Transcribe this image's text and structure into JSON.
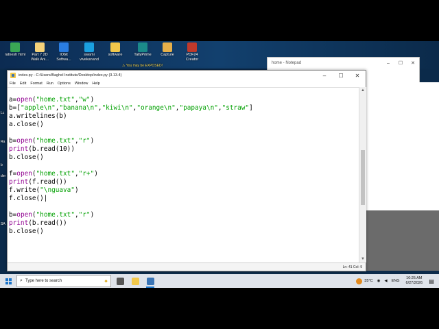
{
  "desktop": {
    "icons": [
      {
        "label": "ratnesh html",
        "color": "#3aa655"
      },
      {
        "label": "Part 7 2D\nWalk Ani...",
        "color": "#f4d27a"
      },
      {
        "label": "IObit\nSoftwa...",
        "color": "#2a7de1"
      },
      {
        "label": "swami\nvivekanand",
        "color": "#1aa0e0"
      },
      {
        "label": "software",
        "color": "#f2c84b"
      },
      {
        "label": "TallyPrime",
        "color": "#1b8a8a"
      },
      {
        "label": "Capture",
        "color": "#e6b04a"
      },
      {
        "label": "PDF24\nCreator",
        "color": "#c0392b"
      }
    ],
    "edge_labels": [
      "Lc",
      "Ra",
      "b",
      "der",
      "SA"
    ],
    "warning": "You may be EXPOSED!"
  },
  "notepad": {
    "title": "home - Notepad",
    "buttons": [
      "–",
      "☐",
      "✕"
    ]
  },
  "idle": {
    "title": "index.py - C:/Users/Baghel Institute/Desktop/index.py (3.13.4)",
    "window_buttons": [
      "–",
      "☐",
      "✕"
    ],
    "menu": [
      "File",
      "Edit",
      "Format",
      "Run",
      "Options",
      "Window",
      "Help"
    ],
    "status": "Ln: 41   Col: 9",
    "code": [
      "",
      [
        {
          "t": "a="
        },
        {
          "t": "open",
          "c": "kw"
        },
        {
          "t": "("
        },
        {
          "t": "\"home.txt\"",
          "c": "st"
        },
        {
          "t": ","
        },
        {
          "t": "\"w\"",
          "c": "st"
        },
        {
          "t": ")"
        }
      ],
      [
        {
          "t": "b=["
        },
        {
          "t": "\"apple\\n\"",
          "c": "st"
        },
        {
          "t": ","
        },
        {
          "t": "\"banana\\n\"",
          "c": "st"
        },
        {
          "t": ","
        },
        {
          "t": "\"kiwi\\n\"",
          "c": "st"
        },
        {
          "t": ","
        },
        {
          "t": "\"orange\\n\"",
          "c": "st"
        },
        {
          "t": ","
        },
        {
          "t": "\"papaya\\n\"",
          "c": "st"
        },
        {
          "t": ","
        },
        {
          "t": "\"straw\"",
          "c": "st"
        },
        {
          "t": "]"
        }
      ],
      "a.writelines(b)",
      "a.close()",
      "",
      [
        {
          "t": "b="
        },
        {
          "t": "open",
          "c": "kw"
        },
        {
          "t": "("
        },
        {
          "t": "\"home.txt\"",
          "c": "st"
        },
        {
          "t": ","
        },
        {
          "t": "\"r\"",
          "c": "st"
        },
        {
          "t": ")"
        }
      ],
      [
        {
          "t": "print",
          "c": "kw"
        },
        {
          "t": "(b.read(10))"
        }
      ],
      "b.close()",
      "",
      [
        {
          "t": "f="
        },
        {
          "t": "open",
          "c": "kw"
        },
        {
          "t": "("
        },
        {
          "t": "\"home.txt\"",
          "c": "st"
        },
        {
          "t": ","
        },
        {
          "t": "\"r+\"",
          "c": "st"
        },
        {
          "t": ")"
        }
      ],
      [
        {
          "t": "print",
          "c": "kw"
        },
        {
          "t": "(f.read())"
        }
      ],
      [
        {
          "t": "f.write("
        },
        {
          "t": "\"\\nguava\"",
          "c": "st"
        },
        {
          "t": ")"
        }
      ],
      "f.close()|",
      "",
      [
        {
          "t": "b="
        },
        {
          "t": "open",
          "c": "kw"
        },
        {
          "t": "("
        },
        {
          "t": "\"home.txt\"",
          "c": "st"
        },
        {
          "t": ","
        },
        {
          "t": "\"r\"",
          "c": "st"
        },
        {
          "t": ")"
        }
      ],
      [
        {
          "t": "print",
          "c": "kw"
        },
        {
          "t": "(b.read())"
        }
      ],
      "b.close()"
    ]
  },
  "taskbar": {
    "search_placeholder": "Type here to search",
    "apps": [
      {
        "name": "task-view",
        "color": "#555555",
        "active": false
      },
      {
        "name": "file-explorer",
        "color": "#f2c84b",
        "active": false
      },
      {
        "name": "python-idle",
        "color": "#3a74b5",
        "active": true
      }
    ],
    "weather": "35°C",
    "language": "ENG",
    "time": "10:25 AM",
    "date": "6/27/2026"
  }
}
